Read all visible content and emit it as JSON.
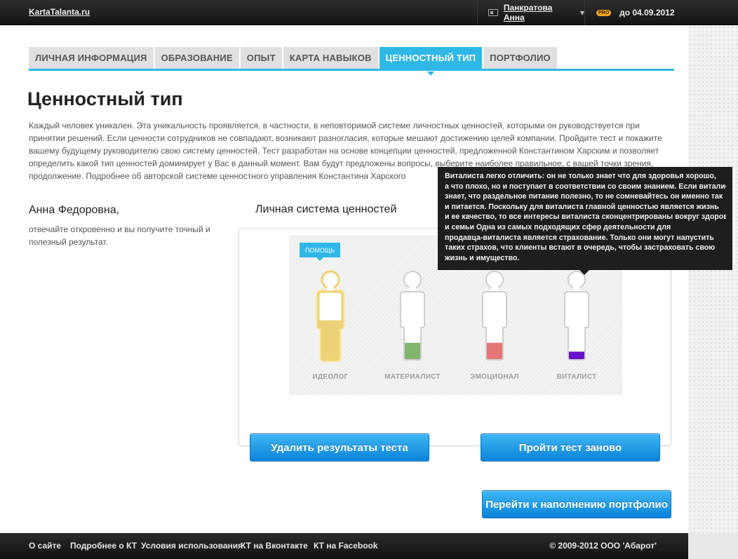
{
  "header": {
    "logo": "KartaTalanta.ru",
    "user_name": "Панкратова Анна",
    "pro_badge": "PRO",
    "pro_until": "до 04.09.2012"
  },
  "tabs": [
    {
      "label": "ЛИЧНАЯ ИНФОРМАЦИЯ",
      "active": false
    },
    {
      "label": "ОБРАЗОВАНИЕ",
      "active": false
    },
    {
      "label": "ОПЫТ",
      "active": false
    },
    {
      "label": "КАРТА НАВЫКОВ",
      "active": false
    },
    {
      "label": "ЦЕННОСТНЫЙ ТИП",
      "active": true
    },
    {
      "label": "ПОРТФОЛИО",
      "active": false
    }
  ],
  "main": {
    "title": "Ценностный тип",
    "intro": "Каждый человек уникален. Эта уникальность проявляется, в частности, в неповторимой системе личностных ценностей, которыми он руководствуется при принятии решений. Если ценности сотрудников не совпадают, возникают разногласия, которые мешают достижению целей компании. Пройдите тест и покажите вашему будущему руководителю свою систему ценностей. Тест разработан на основе концепции ценностей, предложенной Константином Харским и позволяет определить какой тип ценностей доминирует у Вас в данный момент. Вам будут предложены вопросы, выберите наиболее правильное, с вашей точки зрения, продолжение. Подробнее об авторской системе ценностного управления Константина Харского",
    "person_name": "Анна Федоровна,",
    "person_hint": "отвечайте откровенно и вы получите точный и полезный результат.",
    "system_title": "Личная система ценностей",
    "help_badge": "ПОМОЩЬ"
  },
  "value_types": [
    {
      "label": "ИДЕОЛОГ",
      "fill_fraction": 0.58,
      "color": "#ecd176",
      "highlighted": true
    },
    {
      "label": "МАТЕРИАЛИСТ",
      "fill_fraction": 0.25,
      "color": "#83b56c",
      "highlighted": false
    },
    {
      "label": "ЭМОЦИОНАЛ",
      "fill_fraction": 0.25,
      "color": "#e47676",
      "highlighted": false
    },
    {
      "label": "ВИТАЛИСТ",
      "fill_fraction": 0.12,
      "color": "#6a10c8",
      "highlighted": false
    }
  ],
  "tooltip": {
    "lines": [
      "Виталиста легко отличить: он не только знает что для здоровья хорошо,",
      "а что плохо, но и поступает в соответствии со своим знанием. Если виталист",
      "знает, что раздельное питание полезно, то не сомневайтесь он именно так",
      "и питается. Поскольку для виталиста главной ценностью является жизнь",
      "и ее качество, то все интересы виталиста сконцентрированы вокруг здоровья",
      "и семьи Одна из самых подходящих сфер деятельности для",
      "продавца-виталиста является страхование. Только они могут напустить",
      "таких страхов, что клиенты встают в очередь, чтобы застраховать свою",
      "жизнь и имущество."
    ]
  },
  "buttons": {
    "delete_results": "Удалить результаты теста",
    "retake_test": "Пройти тест заново",
    "go_portfolio": "Перейти к наполнению портфолио"
  },
  "footer": {
    "links": [
      "О сайте",
      "Подробнее о КТ",
      "Условия использования",
      "КТ на Вконтакте",
      "КТ на Facebook"
    ],
    "copyright": "© 2009-2012 ООО 'Абарот'"
  },
  "colors": {
    "accent": "#2fb8e6",
    "button": "#0a84d8",
    "highlight": "#f2cf55"
  }
}
